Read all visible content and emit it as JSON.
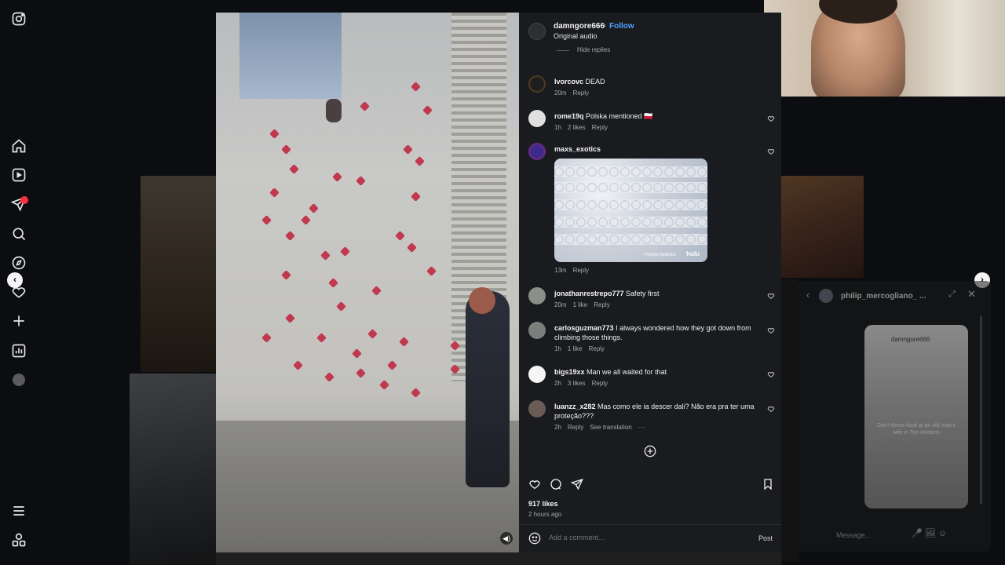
{
  "post": {
    "username": "damngore666",
    "separator": "•",
    "follow_label": "Follow",
    "audio": "Original audio",
    "hide_replies": "Hide replies",
    "likes": "917 likes",
    "time_ago": "2 hours ago"
  },
  "comments": [
    {
      "user": "lvorcovc",
      "text": "DEAD",
      "time": "20m",
      "likes": "",
      "reply": "Reply"
    },
    {
      "user": "rome19q",
      "text": "Polska mentioned 🇵🇱",
      "time": "1h",
      "likes": "2 likes",
      "reply": "Reply"
    },
    {
      "user": "maxs_exotics",
      "text": "",
      "time": "13m",
      "likes": "",
      "reply": "Reply",
      "image_tag": "hulu",
      "image_tag2": "YOUNG HEROES"
    },
    {
      "user": "jonathanrestrepo777",
      "text": "Safety first",
      "time": "20m",
      "likes": "1 like",
      "reply": "Reply"
    },
    {
      "user": "carlosguzman773",
      "text": "I always wondered how they got down from climbing those things.",
      "time": "1h",
      "likes": "1 like",
      "reply": "Reply"
    },
    {
      "user": "bigs19xx",
      "text": "Man we all waited for that",
      "time": "2h",
      "likes": "3 likes",
      "reply": "Reply"
    },
    {
      "user": "luanzz_x282",
      "text": "Mas como ele ia descer dali? Não era pra ter uma proteção???",
      "time": "2h",
      "likes": "",
      "reply": "Reply",
      "translate": "See translation",
      "more": "···"
    }
  ],
  "comment_box": {
    "placeholder": "Add a comment...",
    "post_label": "Post"
  },
  "nav": {
    "prev": "‹",
    "next": "›"
  },
  "dm": {
    "name": "philip_mercogliano_ ...",
    "card_user": "damngore666",
    "card_caption": "Don't throw food at an old man's wife in Tim Hortons",
    "message_placeholder": "Message..."
  },
  "colors": {
    "accent": "#4da3ff",
    "background": "#0b0d10",
    "panel": "#191b1f",
    "notification": "#ff3040"
  }
}
